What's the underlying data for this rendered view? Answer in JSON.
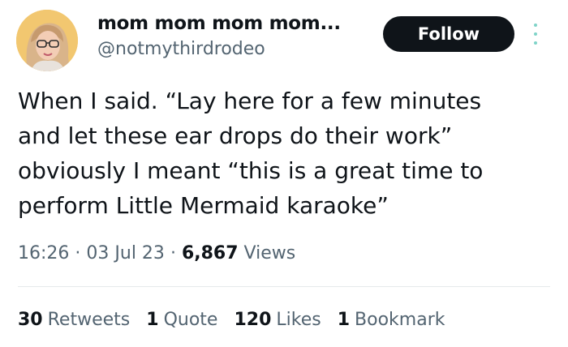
{
  "user": {
    "display_name": "mom mom mom mom...",
    "handle": "@notmythirdrodeo"
  },
  "actions": {
    "follow_label": "Follow",
    "more_icon": "more-vertical-icon"
  },
  "tweet": {
    "text_lines": [
      "When I said. “Lay here for a few minutes",
      "and let these ear drops do their work”",
      "obviously I meant “this is a great time to",
      "perform Little Mermaid karaoke”"
    ],
    "time": "16:26",
    "separator": "·",
    "date": "03 Jul 23",
    "views_count": "6,867",
    "views_label": "Views"
  },
  "stats": [
    {
      "count": "30",
      "label": "Retweets"
    },
    {
      "count": "1",
      "label": "Quote"
    },
    {
      "count": "120",
      "label": "Likes"
    },
    {
      "count": "1",
      "label": "Bookmark"
    }
  ],
  "colors": {
    "primary_text": "#0f1419",
    "secondary_text": "#536471",
    "follow_bg": "#0f1419",
    "divider": "#e6e9eb"
  }
}
